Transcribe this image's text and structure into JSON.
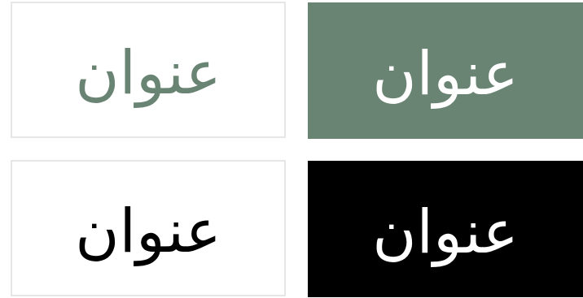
{
  "tiles": [
    {
      "word": "عنوان",
      "background": "#ffffff",
      "text_color": "#6a8474",
      "bordered": true
    },
    {
      "word": "عنوان",
      "background": "#6a8474",
      "text_color": "#ffffff",
      "bordered": false
    },
    {
      "word": "عنوان",
      "background": "#ffffff",
      "text_color": "#000000",
      "bordered": true
    },
    {
      "word": "عنوان",
      "background": "#000000",
      "text_color": "#ffffff",
      "bordered": false
    }
  ],
  "colors": {
    "brand_green": "#6a8474",
    "black": "#000000",
    "white": "#ffffff",
    "border": "#e6e6e6"
  }
}
